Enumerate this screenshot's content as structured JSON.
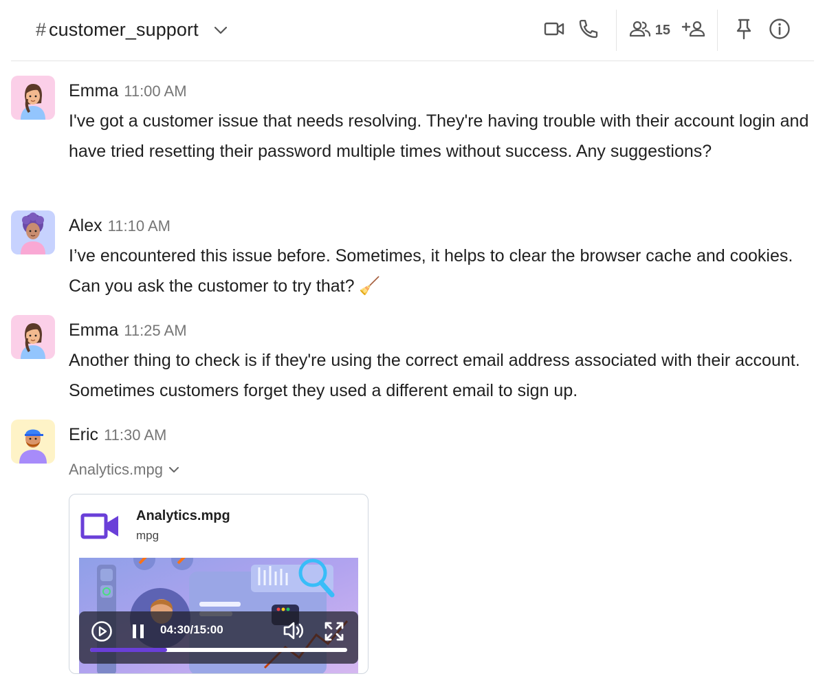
{
  "header": {
    "hash": "#",
    "channel_name": "customer_support",
    "member_count": "15"
  },
  "icons": {
    "video": "video-camera-icon",
    "phone": "phone-icon",
    "members": "people-icon",
    "add_member": "add-person-icon",
    "pin": "pin-icon",
    "info": "info-icon"
  },
  "messages": [
    {
      "author": "Emma",
      "time": "11:00 AM",
      "text": "I've got a customer issue that needs resolving. They're having trouble with their account login and have tried resetting their password multiple times without success. Any suggestions?"
    },
    {
      "author": "Alex",
      "time": "11:10 AM",
      "text": "I’ve encountered this issue before. Sometimes, it helps to clear the browser cache and cookies. Can you ask the customer to try that? 🧹"
    },
    {
      "author": "Emma",
      "time": "11:25 AM",
      "text": "Another thing to check is if they're using the correct email address associated with their account. Sometimes customers forget they used a different email to sign up."
    },
    {
      "author": "Eric",
      "time": "11:30 AM",
      "attachment": {
        "toggle_label": "Analytics.mpg",
        "file_name": "Analytics.mpg",
        "file_type": "mpg",
        "video": {
          "time_display": "04:30/15:00",
          "progress": 0.3
        }
      }
    }
  ],
  "colors": {
    "accent": "#6a3fd8",
    "emma_avatar_bg": "#fbcfe8",
    "alex_avatar_bg": "#c7d2fe",
    "eric_avatar_bg": "#fef3c7"
  }
}
